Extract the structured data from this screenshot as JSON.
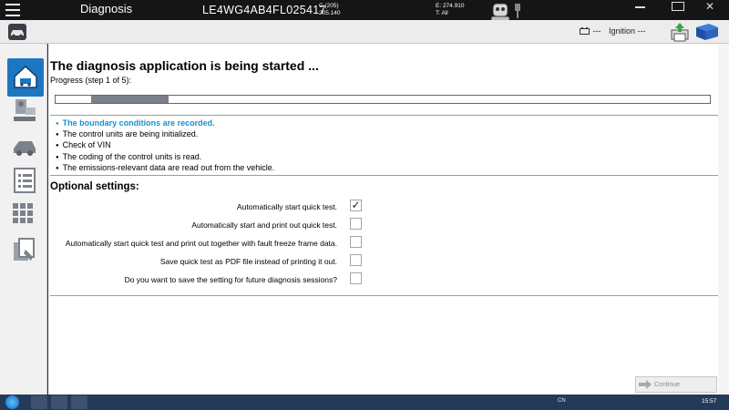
{
  "header": {
    "title": "Diagnosis",
    "vin": "LE4WG4AB4FL025417",
    "c_line1": "C (205)",
    "c_line2": "205.140",
    "e_line": "E: 274.910",
    "t_line": "T: All"
  },
  "subheader": {
    "battery_value": "---",
    "ignition_label": "Ignition ---"
  },
  "nav": {
    "items": [
      {
        "name": "home",
        "active": true
      },
      {
        "name": "vehicle-service"
      },
      {
        "name": "vehicle"
      },
      {
        "name": "list"
      },
      {
        "name": "grid"
      },
      {
        "name": "documents"
      }
    ]
  },
  "main": {
    "heading": "The diagnosis application is being started ...",
    "progress_label": "Progress (step 1 of 5):",
    "progress": {
      "step": 1,
      "total": 5,
      "fraction": 0.17
    },
    "steps": [
      {
        "text": "The boundary conditions are recorded.",
        "current": true
      },
      {
        "text": "The control units are being initialized.",
        "current": false
      },
      {
        "text": "Check of VIN",
        "current": false
      },
      {
        "text": "The coding of the control units is read.",
        "current": false
      },
      {
        "text": "The emissions-relevant data are read out from the vehicle.",
        "current": false
      }
    ],
    "optional_heading": "Optional settings:",
    "options": [
      {
        "label": "Automatically start quick test.",
        "checked": true
      },
      {
        "label": "Automatically start and print out quick test.",
        "checked": false
      },
      {
        "label": "Automatically start quick test and print out together with fault freeze frame data.",
        "checked": false
      },
      {
        "label": "Save quick test as PDF file instead of printing it out.",
        "checked": false
      },
      {
        "label": "Do you want to save the setting for future diagnosis sessions?",
        "checked": false
      }
    ],
    "continue_label": "Continue"
  },
  "taskbar": {
    "tray_lang": "CN",
    "clock": "15:57"
  },
  "colors": {
    "accent": "#1d76c0",
    "current_step": "#1a8fd0",
    "progress_fill": "#7b7f8a",
    "header_bg": "#151515"
  }
}
